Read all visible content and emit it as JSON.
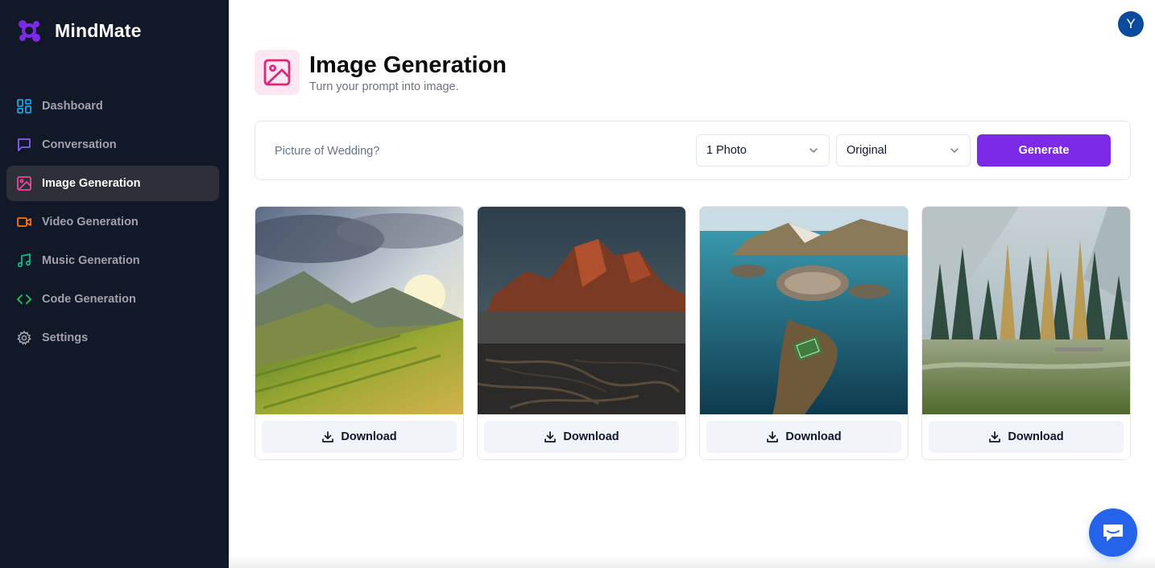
{
  "app": {
    "name": "MindMate",
    "user_initial": "Y"
  },
  "colors": {
    "sidebar_bg": "#111827",
    "accent": "#7c2ae8",
    "chat_fab": "#2563eb",
    "avatar": "#0b4a9c"
  },
  "sidebar": {
    "items": [
      {
        "label": "Dashboard",
        "icon": "layout-grid-icon",
        "color": "#0ea5e9",
        "active": false
      },
      {
        "label": "Conversation",
        "icon": "message-square-icon",
        "color": "#8b5cf6",
        "active": false
      },
      {
        "label": "Image Generation",
        "icon": "image-icon",
        "color": "#ec4899",
        "active": true
      },
      {
        "label": "Video Generation",
        "icon": "video-icon",
        "color": "#f97316",
        "active": false
      },
      {
        "label": "Music Generation",
        "icon": "music-icon",
        "color": "#10b981",
        "active": false
      },
      {
        "label": "Code Generation",
        "icon": "code-icon",
        "color": "#22c55e",
        "active": false
      },
      {
        "label": "Settings",
        "icon": "settings-icon",
        "color": "#a1a1aa",
        "active": false
      }
    ]
  },
  "header": {
    "title": "Image Generation",
    "subtitle": "Turn your prompt into image.",
    "icon": "image-icon"
  },
  "form": {
    "prompt_placeholder": "Picture of Wedding?",
    "prompt_value": "",
    "amount_selected": "1 Photo",
    "resolution_selected": "Original",
    "generate_label": "Generate"
  },
  "gallery": {
    "download_label": "Download",
    "images": [
      {
        "subject": "terraced rice fields at sunset"
      },
      {
        "subject": "rocky mountain peak with roots"
      },
      {
        "subject": "aerial coastal village island"
      },
      {
        "subject": "misty pine forest meadow"
      }
    ]
  }
}
